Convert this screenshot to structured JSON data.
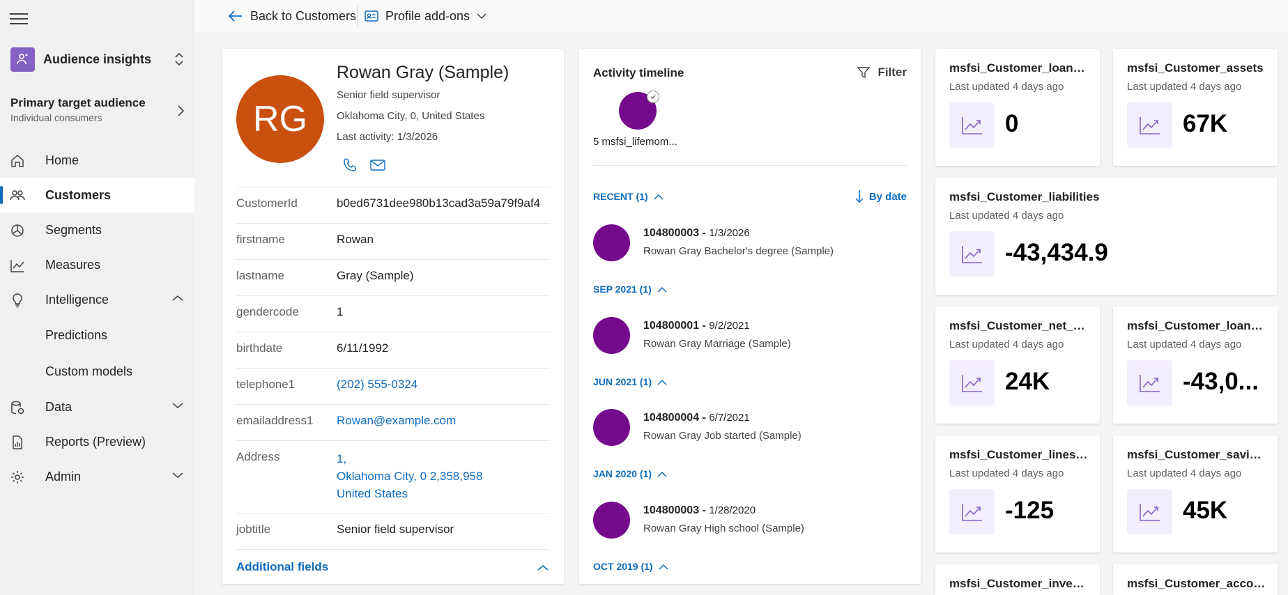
{
  "app": {
    "title": "Audience insights",
    "audience_title": "Primary target audience",
    "audience_subtitle": "Individual consumers"
  },
  "nav": {
    "home": "Home",
    "customers": "Customers",
    "segments": "Segments",
    "measures": "Measures",
    "intelligence": "Intelligence",
    "predictions": "Predictions",
    "custom_models": "Custom models",
    "data": "Data",
    "reports": "Reports (Preview)",
    "admin": "Admin"
  },
  "topbar": {
    "back_label": "Back to Customers",
    "addons_label": "Profile add-ons"
  },
  "profile": {
    "initials": "RG",
    "avatar_color": "#ca5010",
    "name": "Rowan Gray (Sample)",
    "job": "Senior field supervisor",
    "location": "Oklahoma City, 0, United States",
    "last_activity": "Last activity: 1/3/2026",
    "fields": [
      {
        "key": "CustomerId",
        "value": "b0ed6731dee980b13cad3a59a79f9af4"
      },
      {
        "key": "firstname",
        "value": "Rowan"
      },
      {
        "key": "lastname",
        "value": "Gray (Sample)"
      },
      {
        "key": "gendercode",
        "value": "1"
      },
      {
        "key": "birthdate",
        "value": "6/11/1992"
      },
      {
        "key": "telephone1",
        "value": "(202) 555-0324"
      },
      {
        "key": "emailaddress1",
        "value": "Rowan@example.com"
      },
      {
        "key": "Address",
        "line1": "1,",
        "line2": "Oklahoma City, 0 2,358,958",
        "line3": "United States"
      },
      {
        "key": "jobtitle",
        "value": "Senior field supervisor"
      }
    ],
    "additional_fields": "Additional fields"
  },
  "timeline": {
    "title": "Activity timeline",
    "filter": "Filter",
    "bubble_label": "5 msfsi_lifemom...",
    "sort": "By date",
    "groups": [
      "RECENT (1)",
      "SEP 2021 (1)",
      "JUN 2021 (1)",
      "JAN 2020 (1)",
      "OCT 2019 (1)"
    ],
    "items": [
      {
        "code": "104800003",
        "date": "1/3/2026",
        "desc": "Rowan Gray Bachelor's degree (Sample)"
      },
      {
        "code": "104800001",
        "date": "9/2/2021",
        "desc": "Rowan Gray Marriage (Sample)"
      },
      {
        "code": "104800004",
        "date": "6/7/2021",
        "desc": "Rowan Gray Job started (Sample)"
      },
      {
        "code": "104800003",
        "date": "1/28/2020",
        "desc": "Rowan Gray High school (Sample)"
      }
    ],
    "dash": " - ",
    "accent": "#750b8c"
  },
  "measures": {
    "updated": "Last updated 4 days ago",
    "tiles": [
      {
        "name": "msfsi_Customer_loans_...",
        "value": "0"
      },
      {
        "name": "msfsi_Customer_assets",
        "value": "67K"
      },
      {
        "name": "msfsi_Customer_liabilities",
        "value": "-43,434.9"
      },
      {
        "name": "msfsi_Customer_net_w...",
        "value": "24K"
      },
      {
        "name": "msfsi_Customer_loans_...",
        "value": "-43,0..."
      },
      {
        "name": "msfsi_Customer_lines_...",
        "value": "-125"
      },
      {
        "name": "msfsi_Customer_savin...",
        "value": "45K"
      },
      {
        "name": "msfsi_Customer_invest...",
        "value": ""
      },
      {
        "name": "msfsi_Customer_accou...",
        "value": ""
      }
    ]
  }
}
